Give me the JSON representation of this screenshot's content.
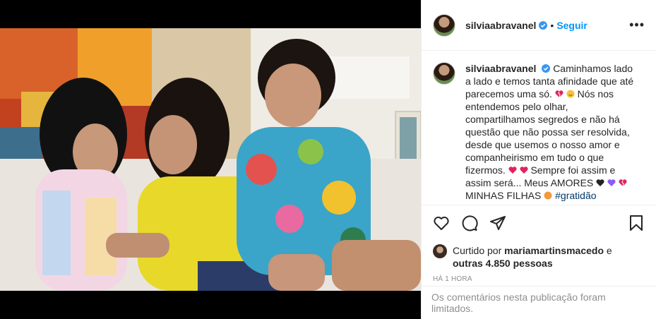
{
  "post": {
    "username": "silviaabravanel",
    "follow_label": "Seguir",
    "more_label": "•••",
    "caption_text": "Caminhamos lado a lado e temos tanta afinidade que até parecemos uma só.",
    "caption_text2": "Nós nos entendemos pelo olhar, compartilhamos segredos e não há questão que não possa ser resolvida, desde que usemos o nosso amor e companheirismo em tudo o que fizermos.",
    "caption_text3": "Sempre foi assim e assim será... Meus AMORES",
    "caption_text4": "MINHAS FILHAS",
    "hashtag": "#gratidão",
    "likes_prefix": "Curtido por",
    "liked_by_user": "mariamartinsmacedo",
    "likes_suffix_e": "e",
    "likes_others": "outras 4.850 pessoas",
    "timestamp": "HÁ 1 HORA",
    "comments_limited": "Os comentários nesta publicação foram limitados."
  },
  "icons": {
    "verified": "verified-badge-icon",
    "like": "heart-icon",
    "comment": "comment-icon",
    "share": "paper-plane-icon",
    "save": "bookmark-icon",
    "more": "more-options-icon"
  },
  "colors": {
    "link_blue": "#0095f6",
    "text": "#262626",
    "muted": "#8e8e8e",
    "hashtag": "#00376b"
  }
}
